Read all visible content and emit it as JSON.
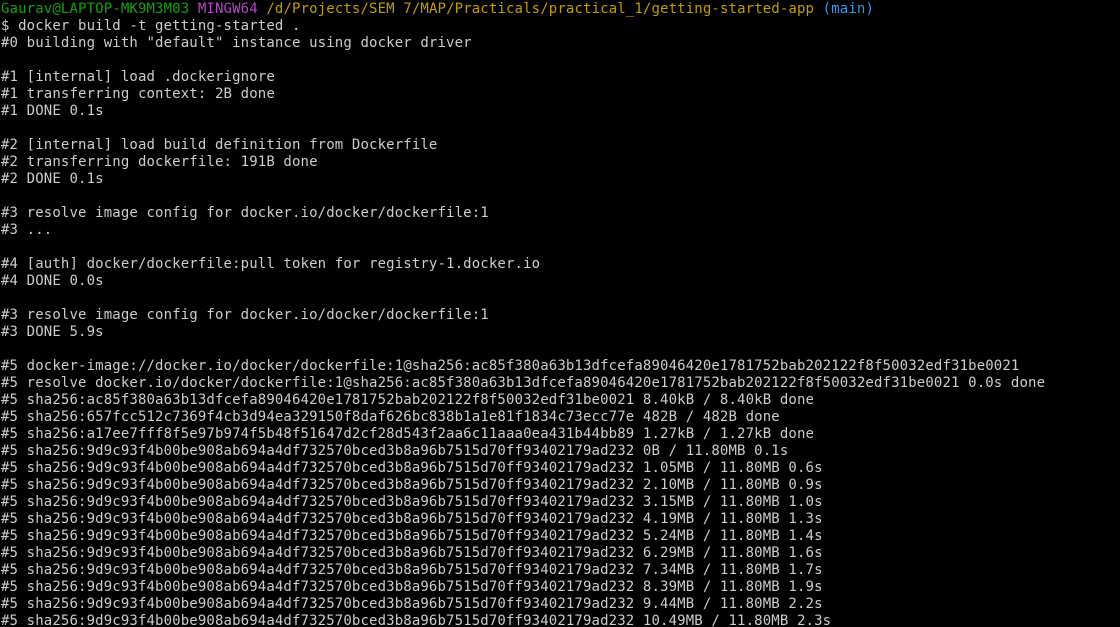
{
  "colors": {
    "background": "#000000",
    "text": "#cccccc",
    "green": "#13a10e",
    "magenta": "#b148c6",
    "yellow": "#c19c00",
    "cyan": "#3a96dd"
  },
  "terminal": {
    "lines": [
      {
        "segments": [
          {
            "text": "Gaurav@LAPTOP-MK9M3M03",
            "color": "green"
          },
          {
            "text": " ",
            "color": "default"
          },
          {
            "text": "MINGW64",
            "color": "magenta"
          },
          {
            "text": " ",
            "color": "default"
          },
          {
            "text": "/d/Projects/SEM 7/MAP/Practicals/practical_1/getting-started-app",
            "color": "yellow"
          },
          {
            "text": " ",
            "color": "default"
          },
          {
            "text": "(main)",
            "color": "cyan"
          }
        ]
      },
      {
        "segments": [
          {
            "text": "$ docker build -t getting-started .",
            "color": "default"
          }
        ]
      },
      {
        "segments": [
          {
            "text": "#0 building with \"default\" instance using docker driver",
            "color": "default"
          }
        ]
      },
      {
        "segments": [
          {
            "text": "",
            "color": "default"
          }
        ]
      },
      {
        "segments": [
          {
            "text": "#1 [internal] load .dockerignore",
            "color": "default"
          }
        ]
      },
      {
        "segments": [
          {
            "text": "#1 transferring context: 2B done",
            "color": "default"
          }
        ]
      },
      {
        "segments": [
          {
            "text": "#1 DONE 0.1s",
            "color": "default"
          }
        ]
      },
      {
        "segments": [
          {
            "text": "",
            "color": "default"
          }
        ]
      },
      {
        "segments": [
          {
            "text": "#2 [internal] load build definition from Dockerfile",
            "color": "default"
          }
        ]
      },
      {
        "segments": [
          {
            "text": "#2 transferring dockerfile: 191B done",
            "color": "default"
          }
        ]
      },
      {
        "segments": [
          {
            "text": "#2 DONE 0.1s",
            "color": "default"
          }
        ]
      },
      {
        "segments": [
          {
            "text": "",
            "color": "default"
          }
        ]
      },
      {
        "segments": [
          {
            "text": "#3 resolve image config for docker.io/docker/dockerfile:1",
            "color": "default"
          }
        ]
      },
      {
        "segments": [
          {
            "text": "#3 ...",
            "color": "default"
          }
        ]
      },
      {
        "segments": [
          {
            "text": "",
            "color": "default"
          }
        ]
      },
      {
        "segments": [
          {
            "text": "#4 [auth] docker/dockerfile:pull token for registry-1.docker.io",
            "color": "default"
          }
        ]
      },
      {
        "segments": [
          {
            "text": "#4 DONE 0.0s",
            "color": "default"
          }
        ]
      },
      {
        "segments": [
          {
            "text": "",
            "color": "default"
          }
        ]
      },
      {
        "segments": [
          {
            "text": "#3 resolve image config for docker.io/docker/dockerfile:1",
            "color": "default"
          }
        ]
      },
      {
        "segments": [
          {
            "text": "#3 DONE 5.9s",
            "color": "default"
          }
        ]
      },
      {
        "segments": [
          {
            "text": "",
            "color": "default"
          }
        ]
      },
      {
        "segments": [
          {
            "text": "#5 docker-image://docker.io/docker/dockerfile:1@sha256:ac85f380a63b13dfcefa89046420e1781752bab202122f8f50032edf31be0021",
            "color": "default"
          }
        ]
      },
      {
        "segments": [
          {
            "text": "#5 resolve docker.io/docker/dockerfile:1@sha256:ac85f380a63b13dfcefa89046420e1781752bab202122f8f50032edf31be0021 0.0s done",
            "color": "default"
          }
        ]
      },
      {
        "segments": [
          {
            "text": "#5 sha256:ac85f380a63b13dfcefa89046420e1781752bab202122f8f50032edf31be0021 8.40kB / 8.40kB done",
            "color": "default"
          }
        ]
      },
      {
        "segments": [
          {
            "text": "#5 sha256:657fcc512c7369f4cb3d94ea329150f8daf626bc838b1a1e81f1834c73ecc77e 482B / 482B done",
            "color": "default"
          }
        ]
      },
      {
        "segments": [
          {
            "text": "#5 sha256:a17ee7fff8f5e97b974f5b48f51647d2cf28d543f2aa6c11aaa0ea431b44bb89 1.27kB / 1.27kB done",
            "color": "default"
          }
        ]
      },
      {
        "segments": [
          {
            "text": "#5 sha256:9d9c93f4b00be908ab694a4df732570bced3b8a96b7515d70ff93402179ad232 0B / 11.80MB 0.1s",
            "color": "default"
          }
        ]
      },
      {
        "segments": [
          {
            "text": "#5 sha256:9d9c93f4b00be908ab694a4df732570bced3b8a96b7515d70ff93402179ad232 1.05MB / 11.80MB 0.6s",
            "color": "default"
          }
        ]
      },
      {
        "segments": [
          {
            "text": "#5 sha256:9d9c93f4b00be908ab694a4df732570bced3b8a96b7515d70ff93402179ad232 2.10MB / 11.80MB 0.9s",
            "color": "default"
          }
        ]
      },
      {
        "segments": [
          {
            "text": "#5 sha256:9d9c93f4b00be908ab694a4df732570bced3b8a96b7515d70ff93402179ad232 3.15MB / 11.80MB 1.0s",
            "color": "default"
          }
        ]
      },
      {
        "segments": [
          {
            "text": "#5 sha256:9d9c93f4b00be908ab694a4df732570bced3b8a96b7515d70ff93402179ad232 4.19MB / 11.80MB 1.3s",
            "color": "default"
          }
        ]
      },
      {
        "segments": [
          {
            "text": "#5 sha256:9d9c93f4b00be908ab694a4df732570bced3b8a96b7515d70ff93402179ad232 5.24MB / 11.80MB 1.4s",
            "color": "default"
          }
        ]
      },
      {
        "segments": [
          {
            "text": "#5 sha256:9d9c93f4b00be908ab694a4df732570bced3b8a96b7515d70ff93402179ad232 6.29MB / 11.80MB 1.6s",
            "color": "default"
          }
        ]
      },
      {
        "segments": [
          {
            "text": "#5 sha256:9d9c93f4b00be908ab694a4df732570bced3b8a96b7515d70ff93402179ad232 7.34MB / 11.80MB 1.7s",
            "color": "default"
          }
        ]
      },
      {
        "segments": [
          {
            "text": "#5 sha256:9d9c93f4b00be908ab694a4df732570bced3b8a96b7515d70ff93402179ad232 8.39MB / 11.80MB 1.9s",
            "color": "default"
          }
        ]
      },
      {
        "segments": [
          {
            "text": "#5 sha256:9d9c93f4b00be908ab694a4df732570bced3b8a96b7515d70ff93402179ad232 9.44MB / 11.80MB 2.2s",
            "color": "default"
          }
        ]
      },
      {
        "segments": [
          {
            "text": "#5 sha256:9d9c93f4b00be908ab694a4df732570bced3b8a96b7515d70ff93402179ad232 10.49MB / 11.80MB 2.3s",
            "color": "default"
          }
        ]
      }
    ]
  }
}
